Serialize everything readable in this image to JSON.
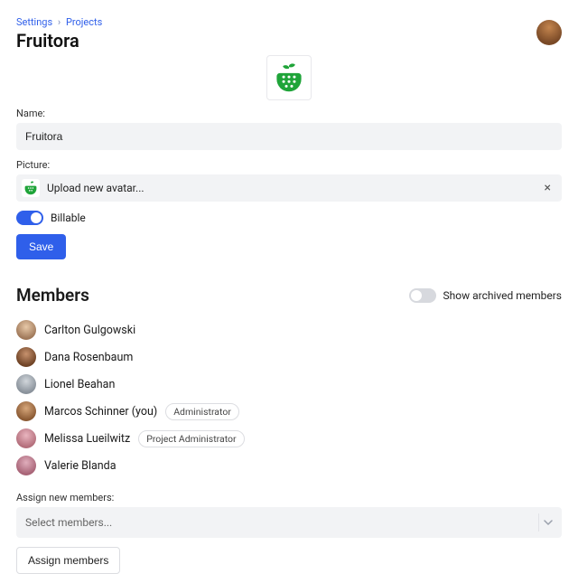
{
  "breadcrumb": {
    "root": "Settings",
    "leaf": "Projects"
  },
  "page_title": "Fruitora",
  "name_field": {
    "label": "Name:",
    "value": "Fruitora"
  },
  "picture_field": {
    "label": "Picture:",
    "upload_text": "Upload new avatar..."
  },
  "billable": {
    "label": "Billable",
    "on": true
  },
  "save_label": "Save",
  "members_section": {
    "title": "Members",
    "show_archived_label": "Show archived members",
    "show_archived_on": false,
    "items": [
      {
        "name": "Carlton Gulgowski",
        "role": null,
        "avatar_bg": "radial-gradient(circle at 50% 35%, #e8c9a8 0%, #a0795a 70%)"
      },
      {
        "name": "Dana Rosenbaum",
        "role": null,
        "avatar_bg": "radial-gradient(circle at 50% 35%, #c7926e 0%, #6f4326 70%)"
      },
      {
        "name": "Lionel Beahan",
        "role": null,
        "avatar_bg": "radial-gradient(circle at 50% 35%, #d1d6db 0%, #8a929b 70%)"
      },
      {
        "name": "Marcos Schinner (you)",
        "role": "Administrator",
        "avatar_bg": "radial-gradient(circle at 50% 35%, #d7a77b 0%, #8b5a33 70%)"
      },
      {
        "name": "Melissa Lueilwitz",
        "role": "Project Administrator",
        "avatar_bg": "radial-gradient(circle at 50% 35%, #e9b5bf 0%, #b46f7c 70%)"
      },
      {
        "name": "Valerie Blanda",
        "role": null,
        "avatar_bg": "radial-gradient(circle at 50% 35%, #e0aebc 0%, #a86477 70%)"
      }
    ]
  },
  "assign": {
    "label": "Assign new members:",
    "placeholder": "Select members...",
    "button": "Assign members"
  },
  "brand_color": "#1fa439"
}
